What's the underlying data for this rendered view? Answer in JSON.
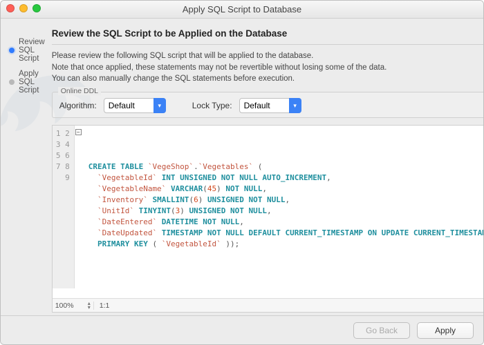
{
  "window": {
    "title": "Apply SQL Script to Database"
  },
  "sidebar": {
    "steps": [
      {
        "label": "Review SQL Script",
        "active": true
      },
      {
        "label": "Apply SQL Script",
        "active": false
      }
    ]
  },
  "main": {
    "heading": "Review the SQL Script to be Applied on the Database",
    "intro1": "Please review the following SQL script that will be applied to the database.",
    "intro2": "Note that once applied, these statements may not be revertible without losing some of the data.",
    "intro3": "You can also manually change the SQL statements before execution."
  },
  "ddl": {
    "legend": "Online DDL",
    "algorithm_label": "Algorithm:",
    "algorithm_value": "Default",
    "lock_label": "Lock Type:",
    "lock_value": "Default"
  },
  "sql": {
    "line_count": 9,
    "lines_html": [
      "<span class='kw'>CREATE TABLE</span> <span class='bt'>`VegeShop`</span><span class='pn'>.</span><span class='bt'>`Vegetables`</span> <span class='pn'>(</span>",
      "  <span class='bt'>`VegetableId`</span> <span class='kw'>INT UNSIGNED NOT NULL AUTO_INCREMENT</span><span class='pn'>,</span>",
      "  <span class='bt'>`VegetableName`</span> <span class='kw'>VARCHAR</span><span class='pn'>(</span><span class='num'>45</span><span class='pn'>)</span> <span class='kw'>NOT NULL</span><span class='pn'>,</span>",
      "  <span class='bt'>`Inventory`</span> <span class='kw'>SMALLINT</span><span class='pn'>(</span><span class='num'>6</span><span class='pn'>)</span> <span class='kw'>UNSIGNED NOT NULL</span><span class='pn'>,</span>",
      "  <span class='bt'>`UnitId`</span> <span class='kw'>TINYINT</span><span class='pn'>(</span><span class='num'>3</span><span class='pn'>)</span> <span class='kw'>UNSIGNED NOT NULL</span><span class='pn'>,</span>",
      "  <span class='bt'>`DateEntered`</span> <span class='kw'>DATETIME NOT NULL</span><span class='pn'>,</span>",
      "  <span class='bt'>`DateUpdated`</span> <span class='kw'>TIMESTAMP NOT NULL DEFAULT CURRENT_TIMESTAMP ON UPDATE CURRENT_TIMESTAMP</span><span class='pn'>,</span>",
      "  <span class='kw'>PRIMARY KEY</span> <span class='pn'>(</span> <span class='bt'>`VegetableId`</span> <span class='pn'>));</span>",
      ""
    ]
  },
  "status": {
    "zoom": "100%",
    "pos": "1:1"
  },
  "footer": {
    "back": "Go Back",
    "apply": "Apply"
  }
}
